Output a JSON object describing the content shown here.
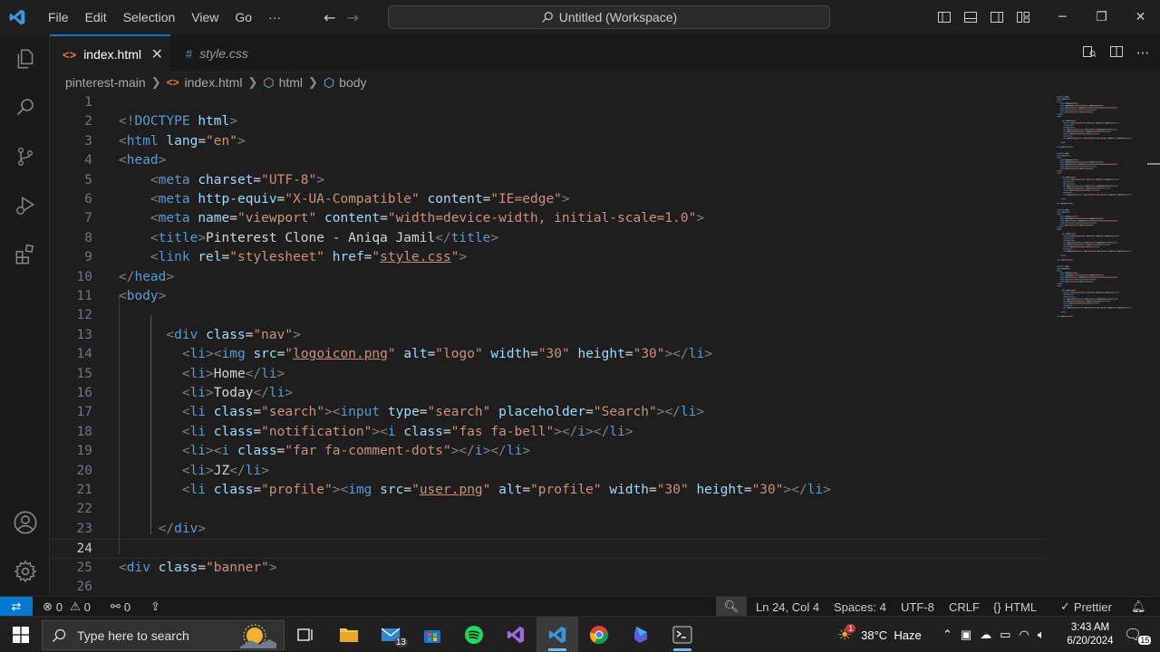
{
  "titlebar": {
    "menu": [
      "File",
      "Edit",
      "Selection",
      "View",
      "Go",
      "···"
    ],
    "command_center": "Untitled (Workspace)",
    "icons": [
      "vscode-logo-icon",
      "back-arrow-icon",
      "forward-arrow-icon",
      "toggle-primary-sidebar-icon",
      "toggle-panel-icon",
      "toggle-secondary-sidebar-icon",
      "customize-layout-icon",
      "minimize-icon",
      "maximize-icon",
      "close-icon"
    ]
  },
  "activitybar": [
    "explorer-icon",
    "search-icon",
    "source-control-icon",
    "run-debug-icon",
    "extensions-icon",
    "accounts-icon",
    "manage-gear-icon"
  ],
  "tabs": [
    {
      "label": "index.html",
      "icon": "<>",
      "active": true
    },
    {
      "label": "style.css",
      "icon": "#",
      "active": false
    }
  ],
  "breadcrumb": [
    "pinterest-main",
    "index.html",
    "html",
    "body"
  ],
  "editor": {
    "active_line": 24,
    "lines": [
      {
        "n": "1",
        "t": []
      },
      {
        "n": "2",
        "t": [
          [
            "br",
            "<!"
          ],
          [
            "tg",
            "DOCTYPE"
          ],
          [
            "tx",
            " "
          ],
          [
            "at",
            "html"
          ],
          [
            "br",
            ">"
          ]
        ]
      },
      {
        "n": "3",
        "t": [
          [
            "br",
            "<"
          ],
          [
            "tg",
            "html"
          ],
          [
            "tx",
            " "
          ],
          [
            "at",
            "lang"
          ],
          [
            "tx",
            "="
          ],
          [
            "st",
            "\"en\""
          ],
          [
            "br",
            ">"
          ]
        ]
      },
      {
        "n": "4",
        "t": [
          [
            "br",
            "<"
          ],
          [
            "tg",
            "head"
          ],
          [
            "br",
            ">"
          ]
        ]
      },
      {
        "n": "5",
        "t": [
          [
            "tx",
            "    "
          ],
          [
            "br",
            "<"
          ],
          [
            "tg",
            "meta"
          ],
          [
            "tx",
            " "
          ],
          [
            "at",
            "charset"
          ],
          [
            "tx",
            "="
          ],
          [
            "st",
            "\"UTF-8\""
          ],
          [
            "br",
            ">"
          ]
        ]
      },
      {
        "n": "6",
        "t": [
          [
            "tx",
            "    "
          ],
          [
            "br",
            "<"
          ],
          [
            "tg",
            "meta"
          ],
          [
            "tx",
            " "
          ],
          [
            "at",
            "http-equiv"
          ],
          [
            "tx",
            "="
          ],
          [
            "st",
            "\"X-UA-Compatible\""
          ],
          [
            "tx",
            " "
          ],
          [
            "at",
            "content"
          ],
          [
            "tx",
            "="
          ],
          [
            "st",
            "\"IE=edge\""
          ],
          [
            "br",
            ">"
          ]
        ]
      },
      {
        "n": "7",
        "t": [
          [
            "tx",
            "    "
          ],
          [
            "br",
            "<"
          ],
          [
            "tg",
            "meta"
          ],
          [
            "tx",
            " "
          ],
          [
            "at",
            "name"
          ],
          [
            "tx",
            "="
          ],
          [
            "st",
            "\"viewport\""
          ],
          [
            "tx",
            " "
          ],
          [
            "at",
            "content"
          ],
          [
            "tx",
            "="
          ],
          [
            "st",
            "\"width=device-width, initial-scale=1.0\""
          ],
          [
            "br",
            ">"
          ]
        ]
      },
      {
        "n": "8",
        "t": [
          [
            "tx",
            "    "
          ],
          [
            "br",
            "<"
          ],
          [
            "tg",
            "title"
          ],
          [
            "br",
            ">"
          ],
          [
            "tx",
            "Pinterest Clone - Aniqa Jamil"
          ],
          [
            "br",
            "</"
          ],
          [
            "tg",
            "title"
          ],
          [
            "br",
            ">"
          ]
        ]
      },
      {
        "n": "9",
        "t": [
          [
            "tx",
            "    "
          ],
          [
            "br",
            "<"
          ],
          [
            "tg",
            "link"
          ],
          [
            "tx",
            " "
          ],
          [
            "at",
            "rel"
          ],
          [
            "tx",
            "="
          ],
          [
            "st",
            "\"stylesheet\""
          ],
          [
            "tx",
            " "
          ],
          [
            "at",
            "href"
          ],
          [
            "tx",
            "="
          ],
          [
            "st",
            "\""
          ],
          [
            "stu",
            "style.css"
          ],
          [
            "st",
            "\""
          ],
          [
            "br",
            ">"
          ]
        ]
      },
      {
        "n": "10",
        "t": [
          [
            "br",
            "</"
          ],
          [
            "tg",
            "head"
          ],
          [
            "br",
            ">"
          ]
        ]
      },
      {
        "n": "11",
        "t": [
          [
            "br",
            "<"
          ],
          [
            "tg",
            "body"
          ],
          [
            "br",
            ">"
          ]
        ]
      },
      {
        "n": "12",
        "t": []
      },
      {
        "n": "13",
        "t": [
          [
            "tx",
            "      "
          ],
          [
            "br",
            "<"
          ],
          [
            "tg",
            "div"
          ],
          [
            "tx",
            " "
          ],
          [
            "at",
            "class"
          ],
          [
            "tx",
            "="
          ],
          [
            "st",
            "\"nav\""
          ],
          [
            "br",
            ">"
          ]
        ]
      },
      {
        "n": "14",
        "t": [
          [
            "tx",
            "        "
          ],
          [
            "br",
            "<"
          ],
          [
            "tg",
            "li"
          ],
          [
            "br",
            "><"
          ],
          [
            "tg",
            "img"
          ],
          [
            "tx",
            " "
          ],
          [
            "at",
            "src"
          ],
          [
            "tx",
            "="
          ],
          [
            "st",
            "\""
          ],
          [
            "stu",
            "logoicon.png"
          ],
          [
            "st",
            "\""
          ],
          [
            "tx",
            " "
          ],
          [
            "at",
            "alt"
          ],
          [
            "tx",
            "="
          ],
          [
            "st",
            "\"logo\""
          ],
          [
            "tx",
            " "
          ],
          [
            "at",
            "width"
          ],
          [
            "tx",
            "="
          ],
          [
            "st",
            "\"30\""
          ],
          [
            "tx",
            " "
          ],
          [
            "at",
            "height"
          ],
          [
            "tx",
            "="
          ],
          [
            "st",
            "\"30\""
          ],
          [
            "br",
            "></"
          ],
          [
            "tg",
            "li"
          ],
          [
            "br",
            ">"
          ]
        ]
      },
      {
        "n": "15",
        "t": [
          [
            "tx",
            "        "
          ],
          [
            "br",
            "<"
          ],
          [
            "tg",
            "li"
          ],
          [
            "br",
            ">"
          ],
          [
            "tx",
            "Home"
          ],
          [
            "br",
            "</"
          ],
          [
            "tg",
            "li"
          ],
          [
            "br",
            ">"
          ]
        ]
      },
      {
        "n": "16",
        "t": [
          [
            "tx",
            "        "
          ],
          [
            "br",
            "<"
          ],
          [
            "tg",
            "li"
          ],
          [
            "br",
            ">"
          ],
          [
            "tx",
            "Today"
          ],
          [
            "br",
            "</"
          ],
          [
            "tg",
            "li"
          ],
          [
            "br",
            ">"
          ]
        ]
      },
      {
        "n": "17",
        "t": [
          [
            "tx",
            "        "
          ],
          [
            "br",
            "<"
          ],
          [
            "tg",
            "li"
          ],
          [
            "tx",
            " "
          ],
          [
            "at",
            "class"
          ],
          [
            "tx",
            "="
          ],
          [
            "st",
            "\"search\""
          ],
          [
            "br",
            "><"
          ],
          [
            "tg",
            "input"
          ],
          [
            "tx",
            " "
          ],
          [
            "at",
            "type"
          ],
          [
            "tx",
            "="
          ],
          [
            "st",
            "\"search\""
          ],
          [
            "tx",
            " "
          ],
          [
            "at",
            "placeholder"
          ],
          [
            "tx",
            "="
          ],
          [
            "st",
            "\"Search\""
          ],
          [
            "br",
            "></"
          ],
          [
            "tg",
            "li"
          ],
          [
            "br",
            ">"
          ]
        ]
      },
      {
        "n": "18",
        "t": [
          [
            "tx",
            "        "
          ],
          [
            "br",
            "<"
          ],
          [
            "tg",
            "li"
          ],
          [
            "tx",
            " "
          ],
          [
            "at",
            "class"
          ],
          [
            "tx",
            "="
          ],
          [
            "st",
            "\"notification\""
          ],
          [
            "br",
            "><"
          ],
          [
            "tg",
            "i"
          ],
          [
            "tx",
            " "
          ],
          [
            "at",
            "class"
          ],
          [
            "tx",
            "="
          ],
          [
            "st",
            "\"fas fa-bell\""
          ],
          [
            "br",
            "></"
          ],
          [
            "tg",
            "i"
          ],
          [
            "br",
            "></"
          ],
          [
            "tg",
            "li"
          ],
          [
            "br",
            ">"
          ]
        ]
      },
      {
        "n": "19",
        "t": [
          [
            "tx",
            "        "
          ],
          [
            "br",
            "<"
          ],
          [
            "tg",
            "li"
          ],
          [
            "br",
            "><"
          ],
          [
            "tg",
            "i"
          ],
          [
            "tx",
            " "
          ],
          [
            "at",
            "class"
          ],
          [
            "tx",
            "="
          ],
          [
            "st",
            "\"far fa-comment-dots\""
          ],
          [
            "br",
            "></"
          ],
          [
            "tg",
            "i"
          ],
          [
            "br",
            "></"
          ],
          [
            "tg",
            "li"
          ],
          [
            "br",
            ">"
          ]
        ]
      },
      {
        "n": "20",
        "t": [
          [
            "tx",
            "        "
          ],
          [
            "br",
            "<"
          ],
          [
            "tg",
            "li"
          ],
          [
            "br",
            ">"
          ],
          [
            "tx",
            "JZ"
          ],
          [
            "br",
            "</"
          ],
          [
            "tg",
            "li"
          ],
          [
            "br",
            ">"
          ]
        ]
      },
      {
        "n": "21",
        "t": [
          [
            "tx",
            "        "
          ],
          [
            "br",
            "<"
          ],
          [
            "tg",
            "li"
          ],
          [
            "tx",
            " "
          ],
          [
            "at",
            "class"
          ],
          [
            "tx",
            "="
          ],
          [
            "st",
            "\"profile\""
          ],
          [
            "br",
            "><"
          ],
          [
            "tg",
            "img"
          ],
          [
            "tx",
            " "
          ],
          [
            "at",
            "src"
          ],
          [
            "tx",
            "="
          ],
          [
            "st",
            "\""
          ],
          [
            "stu",
            "user.png"
          ],
          [
            "st",
            "\""
          ],
          [
            "tx",
            " "
          ],
          [
            "at",
            "alt"
          ],
          [
            "tx",
            "="
          ],
          [
            "st",
            "\"profile\""
          ],
          [
            "tx",
            " "
          ],
          [
            "at",
            "width"
          ],
          [
            "tx",
            "="
          ],
          [
            "st",
            "\"30\""
          ],
          [
            "tx",
            " "
          ],
          [
            "at",
            "height"
          ],
          [
            "tx",
            "="
          ],
          [
            "st",
            "\"30\""
          ],
          [
            "br",
            "></"
          ],
          [
            "tg",
            "li"
          ],
          [
            "br",
            ">"
          ]
        ]
      },
      {
        "n": "22",
        "t": []
      },
      {
        "n": "23",
        "t": [
          [
            "tx",
            "     "
          ],
          [
            "br",
            "</"
          ],
          [
            "tg",
            "div"
          ],
          [
            "br",
            ">"
          ]
        ]
      },
      {
        "n": "24",
        "t": []
      },
      {
        "n": "25",
        "t": [
          [
            "br",
            "<"
          ],
          [
            "tg",
            "div"
          ],
          [
            "tx",
            " "
          ],
          [
            "at",
            "class"
          ],
          [
            "tx",
            "="
          ],
          [
            "st",
            "\"banner\""
          ],
          [
            "br",
            ">"
          ]
        ]
      },
      {
        "n": "26",
        "t": []
      }
    ]
  },
  "statusbar": {
    "errors": "0",
    "warnings": "0",
    "ports": "0",
    "position": "Ln 24, Col 4",
    "spaces": "Spaces: 4",
    "encoding": "UTF-8",
    "eol": "CRLF",
    "language": "HTML",
    "formatter": "Prettier"
  },
  "taskbar": {
    "search_placeholder": "Type here to search",
    "mail_badge": "13",
    "weather": "38°C  Haze",
    "weather_badge": "1",
    "time": "3:43 AM",
    "date": "6/20/2024",
    "notification_count": "15",
    "apps": [
      "task-view-icon",
      "file-explorer-icon",
      "mail-icon",
      "store-icon",
      "spotify-icon",
      "visual-studio-icon",
      "vscode-icon",
      "chrome-icon",
      "copilot-icon",
      "terminal-icon"
    ]
  },
  "colors": {
    "accent": "#0078d4",
    "tag": "#569cd6",
    "attribute": "#9cdcfe",
    "string": "#ce9178",
    "bracket": "#808080",
    "text": "#d4d4d4"
  }
}
